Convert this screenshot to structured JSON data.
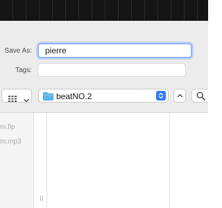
{
  "save_dialog": {
    "save_as_label": "Save As:",
    "save_as_value": "pierre",
    "tags_label": "Tags:",
    "tags_value": "",
    "current_folder": "beatNO.2"
  },
  "toolbar": {
    "view_icon": "icon-grid-icon",
    "view_menu_icon": "chevron-down-icon",
    "folder_icon": "folder-icon",
    "location_stepper_icon": "up-down-chevron-icon",
    "up_icon": "chevron-up-icon",
    "search_icon": "search-icon"
  },
  "browser": {
    "files": [
      "m.flp",
      "m.mp3"
    ]
  },
  "colors": {
    "accent": "#2f7cf6",
    "focus_ring": "#8fb6ff",
    "dialog_bg": "#ececec",
    "folder": "#5ab5f0"
  }
}
